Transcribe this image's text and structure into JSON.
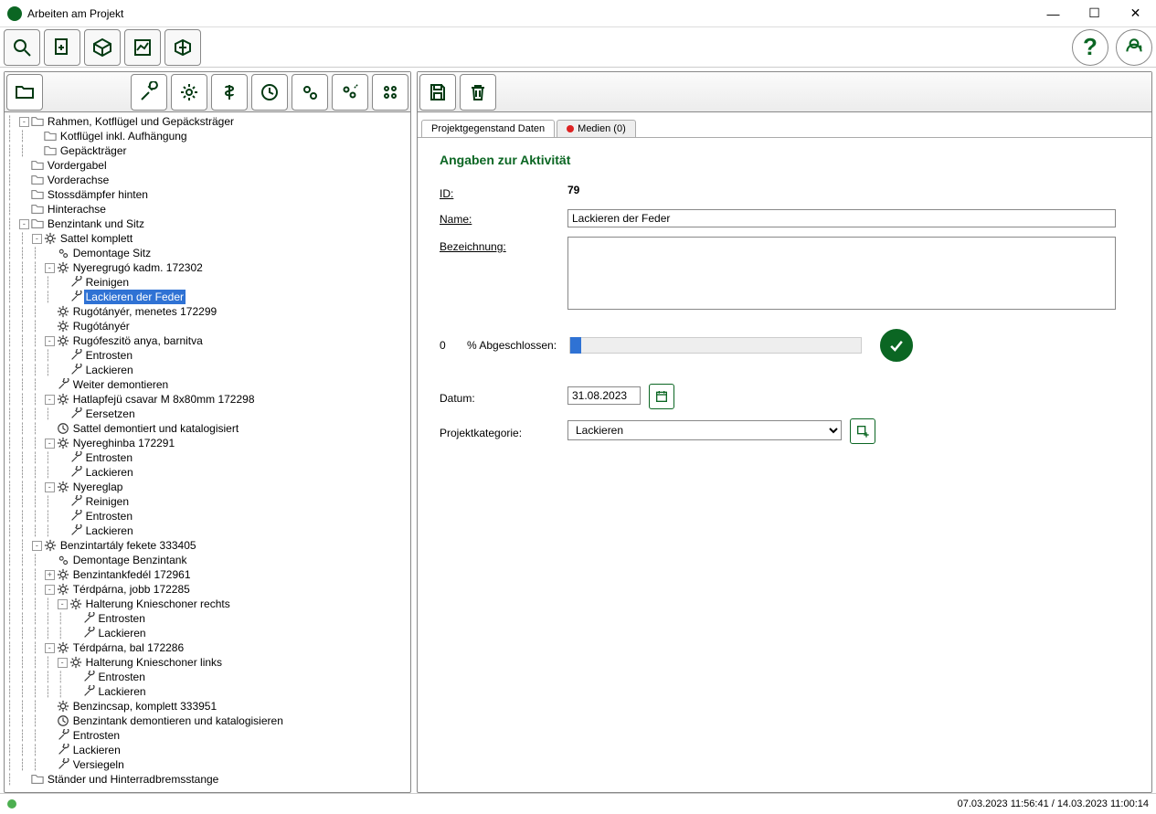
{
  "window": {
    "title": "Arbeiten am Projekt"
  },
  "status": {
    "timestamps": "07.03.2023 11:56:41 / 14.03.2023 11:00:14"
  },
  "tabs": {
    "data": "Projektgegenstand Daten",
    "media": "Medien (0)"
  },
  "form": {
    "section_title": "Angaben zur Aktivität",
    "id_label": "ID:",
    "id_value": "79",
    "name_label": "Name:",
    "name_value": "Lackieren der Feder",
    "desc_label": "Bezeichnung:",
    "desc_value": "",
    "progress_prefix": "0",
    "progress_label": "% Abgeschlossen:",
    "date_label": "Datum:",
    "date_value": "31.08.2023",
    "cat_label": "Projektkategorie:",
    "cat_value": "Lackieren"
  },
  "tree": [
    {
      "d": 1,
      "tg": "-",
      "ic": "folder",
      "t": "Rahmen, Kotflügel und Gepäcksträger"
    },
    {
      "d": 2,
      "tg": "",
      "ic": "folder",
      "t": "Kotflügel inkl. Aufhängung"
    },
    {
      "d": 2,
      "tg": "",
      "ic": "folder",
      "t": "Gepäckträger"
    },
    {
      "d": 1,
      "tg": "",
      "ic": "folder",
      "t": "Vordergabel"
    },
    {
      "d": 1,
      "tg": "",
      "ic": "folder",
      "t": "Vorderachse"
    },
    {
      "d": 1,
      "tg": "",
      "ic": "folder",
      "t": "Stossdämpfer hinten"
    },
    {
      "d": 1,
      "tg": "",
      "ic": "folder",
      "t": "Hinterachse"
    },
    {
      "d": 1,
      "tg": "-",
      "ic": "folder",
      "t": "Benzintank und Sitz"
    },
    {
      "d": 2,
      "tg": "-",
      "ic": "gear",
      "t": "Sattel komplett"
    },
    {
      "d": 3,
      "tg": "",
      "ic": "gear2",
      "t": "Demontage Sitz"
    },
    {
      "d": 3,
      "tg": "-",
      "ic": "gear",
      "t": "Nyeregrugó kadm. 172302"
    },
    {
      "d": 4,
      "tg": "",
      "ic": "wr",
      "t": "Reinigen"
    },
    {
      "d": 4,
      "tg": "",
      "ic": "wr",
      "t": "Lackieren der Feder",
      "sel": true
    },
    {
      "d": 3,
      "tg": "",
      "ic": "gear",
      "t": "Rugótányér, menetes 172299"
    },
    {
      "d": 3,
      "tg": "",
      "ic": "gear",
      "t": "Rugótányér"
    },
    {
      "d": 3,
      "tg": "-",
      "ic": "gear",
      "t": "Rugófeszitö anya, barnitva"
    },
    {
      "d": 4,
      "tg": "",
      "ic": "wr",
      "t": "Entrosten"
    },
    {
      "d": 4,
      "tg": "",
      "ic": "wr",
      "t": "Lackieren"
    },
    {
      "d": 3,
      "tg": "",
      "ic": "wr",
      "t": "Weiter demontieren"
    },
    {
      "d": 3,
      "tg": "-",
      "ic": "gear",
      "t": "Hatlapfejü csavar M 8x80mm 172298"
    },
    {
      "d": 4,
      "tg": "",
      "ic": "wr",
      "t": "Eersetzen"
    },
    {
      "d": 3,
      "tg": "",
      "ic": "clock",
      "t": "Sattel demontiert und katalogisiert"
    },
    {
      "d": 3,
      "tg": "-",
      "ic": "gear",
      "t": "Nyereghinba 172291"
    },
    {
      "d": 4,
      "tg": "",
      "ic": "wr",
      "t": "Entrosten"
    },
    {
      "d": 4,
      "tg": "",
      "ic": "wr",
      "t": "Lackieren"
    },
    {
      "d": 3,
      "tg": "-",
      "ic": "gear",
      "t": "Nyereglap"
    },
    {
      "d": 4,
      "tg": "",
      "ic": "wr",
      "t": "Reinigen"
    },
    {
      "d": 4,
      "tg": "",
      "ic": "wr",
      "t": "Entrosten"
    },
    {
      "d": 4,
      "tg": "",
      "ic": "wr",
      "t": "Lackieren"
    },
    {
      "d": 2,
      "tg": "-",
      "ic": "gear",
      "t": "Benzintartály fekete 333405"
    },
    {
      "d": 3,
      "tg": "",
      "ic": "gear2",
      "t": "Demontage Benzintank"
    },
    {
      "d": 3,
      "tg": "+",
      "ic": "gear",
      "t": "Benzintankfedél 172961"
    },
    {
      "d": 3,
      "tg": "-",
      "ic": "gear",
      "t": "Térdpárna, jobb 172285"
    },
    {
      "d": 4,
      "tg": "-",
      "ic": "gear",
      "t": "Halterung Knieschoner rechts"
    },
    {
      "d": 5,
      "tg": "",
      "ic": "wr",
      "t": "Entrosten"
    },
    {
      "d": 5,
      "tg": "",
      "ic": "wr",
      "t": "Lackieren"
    },
    {
      "d": 3,
      "tg": "-",
      "ic": "gear",
      "t": "Térdpárna, bal 172286"
    },
    {
      "d": 4,
      "tg": "-",
      "ic": "gear",
      "t": "Halterung Knieschoner links"
    },
    {
      "d": 5,
      "tg": "",
      "ic": "wr",
      "t": "Entrosten"
    },
    {
      "d": 5,
      "tg": "",
      "ic": "wr",
      "t": "Lackieren"
    },
    {
      "d": 3,
      "tg": "",
      "ic": "gear",
      "t": "Benzincsap, komplett 333951"
    },
    {
      "d": 3,
      "tg": "",
      "ic": "clock",
      "t": "Benzintank demontieren und katalogisieren"
    },
    {
      "d": 3,
      "tg": "",
      "ic": "wr",
      "t": "Entrosten"
    },
    {
      "d": 3,
      "tg": "",
      "ic": "wr",
      "t": "Lackieren"
    },
    {
      "d": 3,
      "tg": "",
      "ic": "wr",
      "t": "Versiegeln"
    },
    {
      "d": 1,
      "tg": "",
      "ic": "folder",
      "t": "Ständer und Hinterradbremsstange"
    }
  ],
  "icons": {
    "folder": "<svg viewBox='0 0 16 16'><path d='M1 3h5l2 2h7v8H1z' fill='none' stroke='#777' stroke-width='1.2'/></svg>",
    "gear": "<svg viewBox='0 0 16 16'><circle cx='8' cy='8' r='3' fill='none' stroke='#333' stroke-width='1.4'/><g stroke='#333' stroke-width='1.4'><line x1='8' y1='1' x2='8' y2='4'/><line x1='8' y1='12' x2='8' y2='15'/><line x1='1' y1='8' x2='4' y2='8'/><line x1='12' y1='8' x2='15' y2='8'/><line x1='3' y1='3' x2='5' y2='5'/><line x1='11' y1='11' x2='13' y2='13'/><line x1='3' y1='13' x2='5' y2='11'/><line x1='11' y1='5' x2='13' y2='3'/></g></svg>",
    "gear2": "<svg viewBox='0 0 16 16'><circle cx='6' cy='6' r='2.2' fill='none' stroke='#333' stroke-width='1.2'/><circle cx='11' cy='11' r='2.2' fill='none' stroke='#333' stroke-width='1.2'/></svg>",
    "wr": "<svg viewBox='0 0 16 16'><path d='M3 13l6-6M11 5a3 3 0 1 0-2-2l-1 1 2 2z' fill='none' stroke='#333' stroke-width='1.4'/></svg>",
    "clock": "<svg viewBox='0 0 16 16'><circle cx='8' cy='8' r='6' fill='none' stroke='#333' stroke-width='1.3'/><path d='M8 4v4l3 2' fill='none' stroke='#333' stroke-width='1.3'/></svg>"
  }
}
